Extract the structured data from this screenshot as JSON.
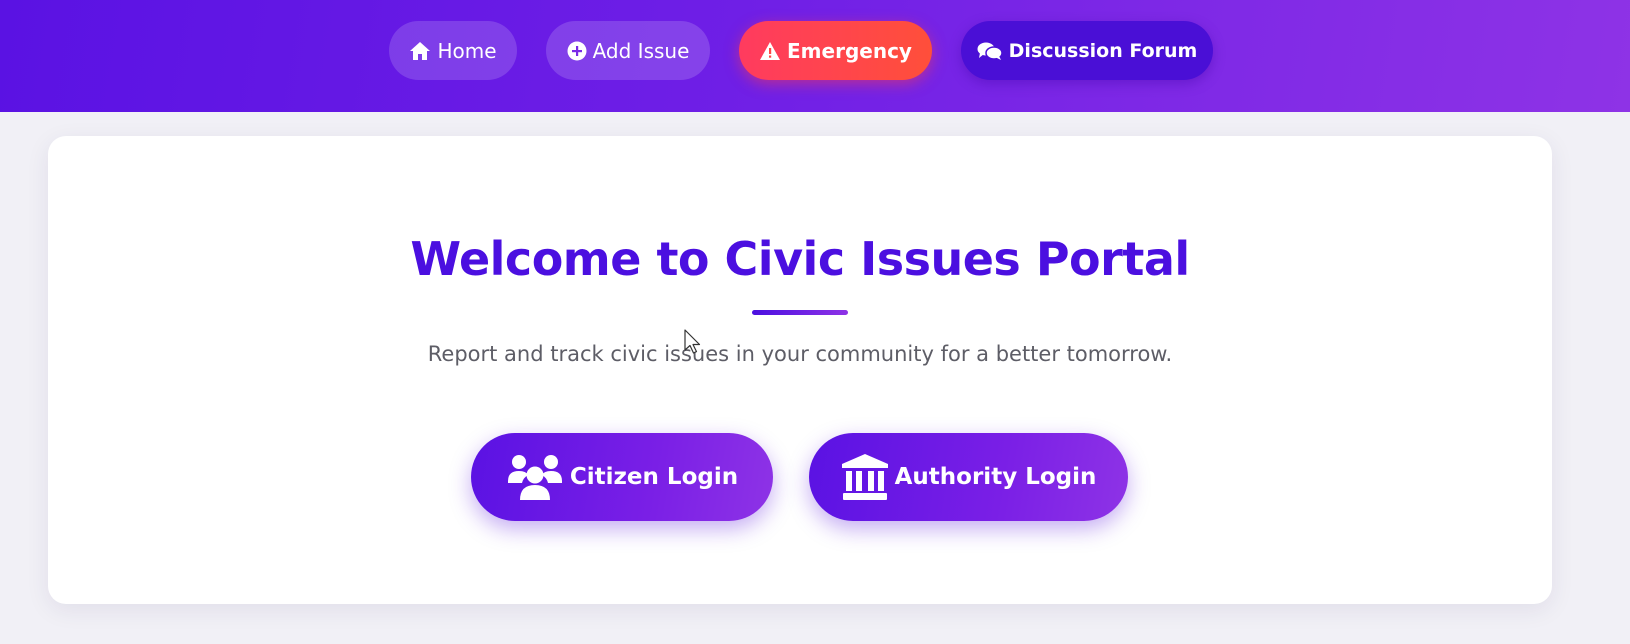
{
  "nav": {
    "home_label": "Home",
    "add_issue_label": "Add Issue",
    "emergency_label": "Emergency",
    "forum_label": "Discussion Forum"
  },
  "main": {
    "title": "Welcome to Civic Issues Portal",
    "subtitle": "Report and track civic issues in your community for a better tomorrow.",
    "citizen_login_label": "Citizen Login",
    "authority_login_label": "Authority Login"
  },
  "icons": {
    "home": "home-icon",
    "add": "plus-circle-icon",
    "emergency": "warning-triangle-icon",
    "forum": "comments-icon",
    "citizen": "users-icon",
    "authority": "landmark-icon"
  },
  "colors": {
    "brand_purple": "#4b0fe0",
    "navbar_start": "#5a12e3",
    "navbar_end": "#8e33e6",
    "emergency_red": "#ff3b5f",
    "forum_dark": "#4a0fd6",
    "background": "#f1f0f6"
  }
}
